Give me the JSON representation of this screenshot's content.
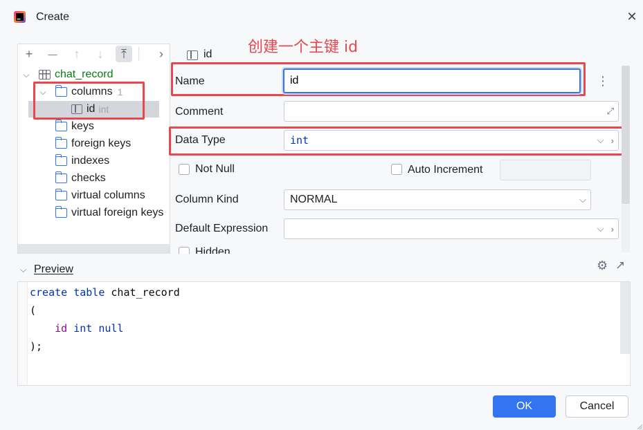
{
  "window": {
    "title": "Create",
    "close": "✕"
  },
  "annotation": "创建一个主键 id",
  "toolbar": {
    "add": "+",
    "remove": "—",
    "up": "↑",
    "down": "↓",
    "top": "⤒",
    "more": "›"
  },
  "tree": {
    "table": "chat_record",
    "columns_label": "columns",
    "columns_count": "1",
    "column_name": "id",
    "column_type": "int",
    "items": [
      "keys",
      "foreign keys",
      "indexes",
      "checks",
      "virtual columns",
      "virtual foreign keys"
    ]
  },
  "header": {
    "column_title": "id"
  },
  "form": {
    "name_label": "Name",
    "name_value": "id",
    "comment_label": "Comment",
    "comment_value": "",
    "datatype_label": "Data Type",
    "datatype_value": "int",
    "not_null_label": "Not Null",
    "auto_increment_label": "Auto Increment",
    "column_kind_label": "Column Kind",
    "column_kind_value": "NORMAL",
    "default_expr_label": "Default Expression",
    "default_expr_value": "",
    "hidden_label": "Hidden"
  },
  "preview": {
    "label": "Preview",
    "lines": {
      "l1_kw": "create table ",
      "l1_name": "chat_record",
      "l2": "(",
      "l3_indent": "    ",
      "l3_col": "id",
      "l3_rest": " int null",
      "l4": ");"
    }
  },
  "buttons": {
    "ok": "OK",
    "cancel": "Cancel"
  }
}
